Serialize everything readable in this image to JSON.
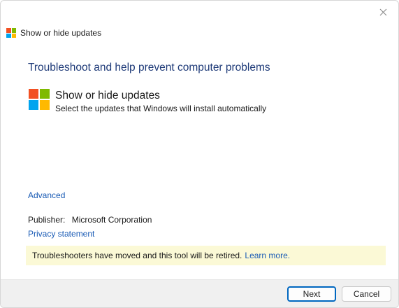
{
  "window": {
    "title": "Show or hide updates",
    "close_icon": "close-icon"
  },
  "content": {
    "heading": "Troubleshoot and help prevent computer problems",
    "tool_name": "Show or hide updates",
    "tool_description": "Select the updates that Windows will install automatically",
    "advanced_link": "Advanced",
    "publisher_label": "Publisher:",
    "publisher_value": "Microsoft Corporation",
    "privacy_link": "Privacy statement"
  },
  "notice": {
    "text": "Troubleshooters have moved and this tool will be retired.",
    "link": "Learn more."
  },
  "buttons": {
    "next": "Next",
    "cancel": "Cancel"
  },
  "colors": {
    "heading": "#1e3a78",
    "link": "#1a5bb5",
    "notice_bg": "#fbf9d6",
    "footer_bg": "#f0f0f0",
    "logo_red": "#f25022",
    "logo_green": "#7fba00",
    "logo_blue": "#00a4ef",
    "logo_yellow": "#ffb900"
  }
}
